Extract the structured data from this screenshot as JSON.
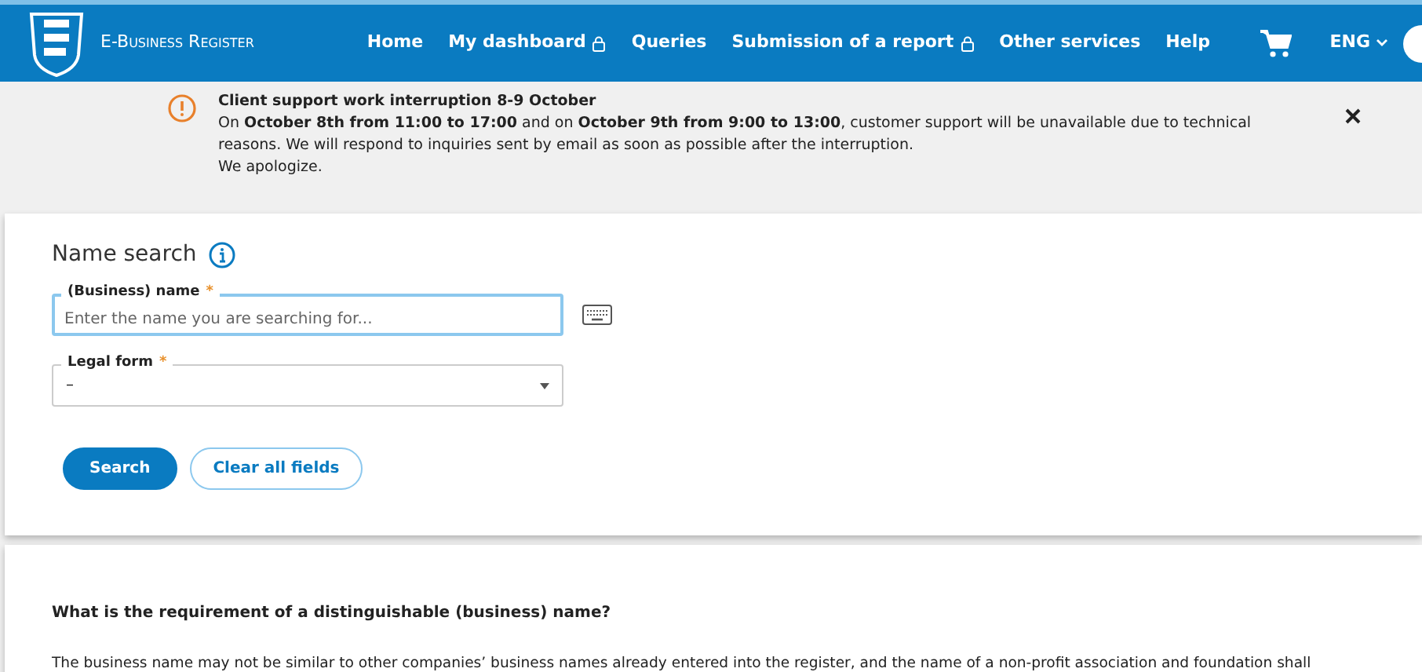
{
  "header": {
    "brand": "E-Business Register",
    "nav": [
      {
        "label": "Home",
        "locked": false
      },
      {
        "label": "My dashboard",
        "locked": true
      },
      {
        "label": "Queries",
        "locked": false
      },
      {
        "label": "Submission of a report",
        "locked": true
      },
      {
        "label": "Other services",
        "locked": false
      },
      {
        "label": "Help",
        "locked": false
      }
    ],
    "language": "ENG"
  },
  "notice": {
    "title": "Client support work interruption 8-9 October",
    "body": "On **October 8th from 11:00 to 17:00** and on **October 9th from 9:00 to 13:00**, customer support will be unavailable due to technical reasons. We will respond to inquiries sent by email as soon as possible after the interruption.",
    "closing": "We apologize."
  },
  "search": {
    "title": "Name search",
    "fields": [
      {
        "kind": "text",
        "label": "(Business) name",
        "required_mark": "*",
        "placeholder": "Enter the name you are searching for...",
        "focused": true
      },
      {
        "kind": "select",
        "label": "Legal form",
        "required_mark": "*",
        "value": "–",
        "focused": false
      }
    ],
    "buttons": [
      {
        "label": "Search",
        "primary": true
      },
      {
        "label": "Clear all fields",
        "primary": false
      }
    ]
  },
  "info": {
    "heading": "What is the requirement of a distinguishable (business) name?",
    "text": "The business name may not be similar to other companies’ business names already entered into the register, and the name of a non-profit association and foundation shall"
  }
}
